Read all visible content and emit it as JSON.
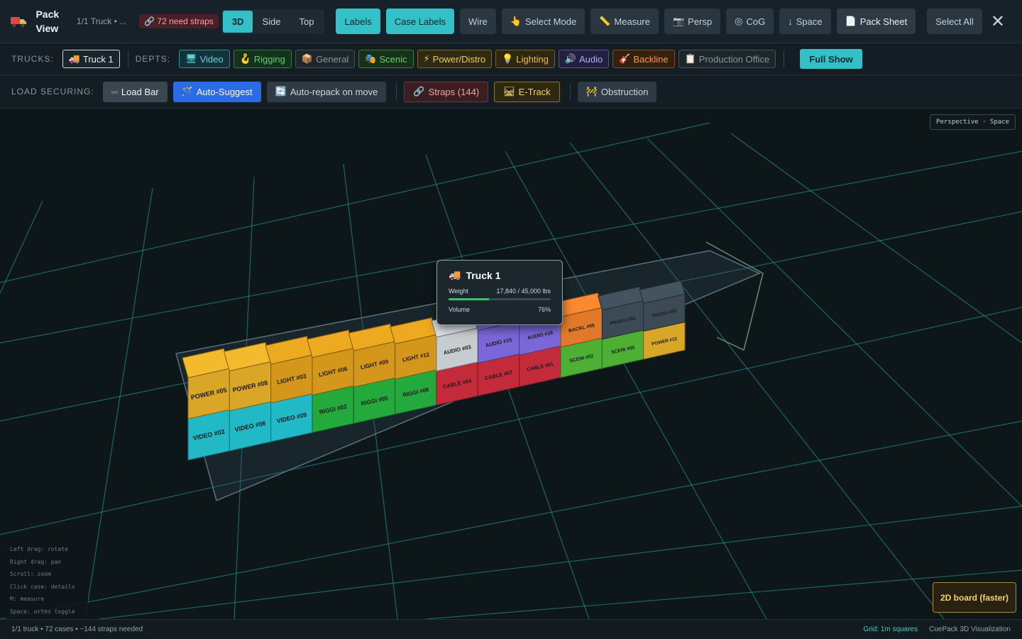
{
  "app": {
    "title": "Pack View",
    "truck_count": "1/1 Truck • ...",
    "strap_warning": "72 need straps"
  },
  "view_modes": [
    {
      "label": "3D",
      "active": true
    },
    {
      "label": "Side",
      "active": false
    },
    {
      "label": "Top",
      "active": false
    }
  ],
  "toolbar": {
    "labels": "Labels",
    "case_labels": "Case Labels",
    "wire": "Wire",
    "select_mode": "Select Mode",
    "measure": "Measure",
    "persp": "Persp",
    "cog": "CoG",
    "space": "Space",
    "pack_sheet": "Pack Sheet",
    "select_all": "Select All"
  },
  "trucks_row": {
    "label": "TRUCKS:",
    "truck": "Truck 1"
  },
  "depts_row": {
    "label": "DEPTS:",
    "items": [
      {
        "label": "Video",
        "color": "#3ec7d0"
      },
      {
        "label": "Rigging",
        "color": "#4fc45a"
      },
      {
        "label": "General",
        "color": "#7c8c92"
      },
      {
        "label": "Scenic",
        "color": "#5ccb5a"
      },
      {
        "label": "Power/Distro",
        "color": "#e8c240"
      },
      {
        "label": "Lighting",
        "color": "#e3b23e"
      },
      {
        "label": "Audio",
        "color": "#a99af0"
      },
      {
        "label": "Backline",
        "color": "#f08a3c"
      },
      {
        "label": "Production Office",
        "color": "#7d8b92"
      }
    ],
    "full_show": "Full Show"
  },
  "load_row": {
    "label": "LOAD SECURING:",
    "load_bar": "Load Bar",
    "auto_suggest": "Auto-Suggest",
    "auto_repack": "Auto-repack on move",
    "straps": "Straps (144)",
    "etrack": "E-Track",
    "obstruction": "Obstruction"
  },
  "viewport": {
    "badge": "Perspective · Space"
  },
  "cases": {
    "front_left": [
      {
        "label": "VIDEO #03",
        "color": "#22b9c7"
      },
      {
        "label": "POWER #05",
        "color": "#d9a628"
      },
      {
        "label": "VIDEO #06",
        "color": "#22b9c7"
      },
      {
        "label": "POWER #08",
        "color": "#d9a628"
      },
      {
        "label": "VIDEO #09",
        "color": "#22b9c7"
      },
      {
        "label": "LIGHT #03",
        "color": "#d4971c"
      },
      {
        "label": "RIGGI #02",
        "color": "#23a93c"
      },
      {
        "label": "LIGHT #06",
        "color": "#d4971c"
      },
      {
        "label": "RIGGI #05",
        "color": "#23a93c"
      },
      {
        "label": "LIGHT #09",
        "color": "#d4971c"
      },
      {
        "label": "RIGGI #08",
        "color": "#23a93c"
      },
      {
        "label": "LIGHT #12",
        "color": "#d4971c"
      },
      {
        "label": "CABLE #04",
        "color": "#c32a3a"
      },
      {
        "label": "AUDIO #03",
        "color": "#c6ccd0"
      },
      {
        "label": "CABLE #07",
        "color": "#c32a3a"
      },
      {
        "label": "AUDIO #15",
        "color": "#7b67d8"
      },
      {
        "label": "CABLE #01",
        "color": "#c32a3a"
      },
      {
        "label": "AUDIO #18",
        "color": "#7b67d8"
      },
      {
        "label": "SCENI #02",
        "color": "#4db034"
      },
      {
        "label": "BACKL #05",
        "color": "#e07a2a"
      },
      {
        "label": "SCENI #05",
        "color": "#4db034"
      },
      {
        "label": "PRODU #01",
        "color": "#3c4a55"
      },
      {
        "label": "POWER #12",
        "color": "#d9a628"
      },
      {
        "label": "PRODU #04",
        "color": "#3c4a55"
      }
    ]
  },
  "tooltip": {
    "title": "Truck 1",
    "weight_label": "Weight",
    "weight_value": "17,840 / 45,000 lbs",
    "weight_fraction": 0.396,
    "volume_label": "Volume",
    "volume_value": "76%"
  },
  "help": [
    "Left drag: rotate",
    "Right drag: pan",
    "Scroll: zoom",
    "Click case: details",
    "M: measure",
    "Space: ortho toggle"
  ],
  "board_button": "2D board (faster)",
  "status": {
    "left": "1/1 truck • 72 cases • ~144 straps needed",
    "grid": "Grid: 1m squares",
    "brand": "CuePack 3D Visualization"
  }
}
